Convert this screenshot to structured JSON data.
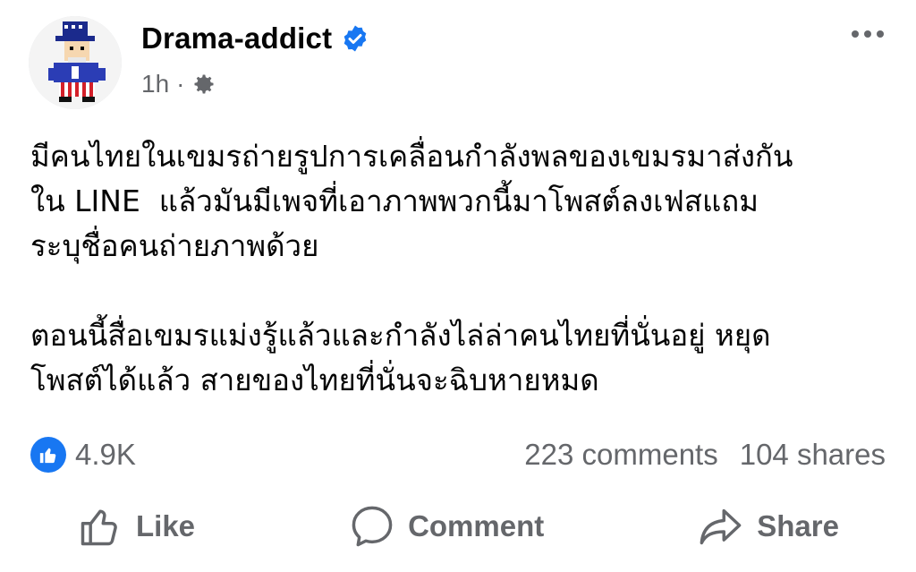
{
  "post": {
    "author": "Drama-addict",
    "time": "1h",
    "separator": "·",
    "text": "มีคนไทยในเขมรถ่ายรูปการเคลื่อนกำลังพลของเขมรมาส่งกัน\nใน LINE  แล้วมันมีเพจที่เอาภาพพวกนี้มาโพสต์ลงเฟสแถม\nระบุชื่อคนถ่ายภาพด้วย\n\nตอนนี้สื่อเขมรแม่งรู้แล้วและกำลังไล่ล่าคนไทยที่นั่นอยู่ หยุด\nโพสต์ได้แล้ว สายของไทยที่นั่นจะฉิบหายหมด"
  },
  "stats": {
    "reactions": "4.9K",
    "comments": "223 comments",
    "shares": "104 shares"
  },
  "actions": {
    "like": "Like",
    "comment": "Comment",
    "share": "Share"
  },
  "icons": {
    "verified": "verified-badge-icon",
    "privacy": "gear-icon",
    "more": "more-options-icon",
    "reaction": "thumbs-up-icon"
  },
  "colors": {
    "accent": "#1877f2",
    "secondary_text": "#65676b"
  }
}
